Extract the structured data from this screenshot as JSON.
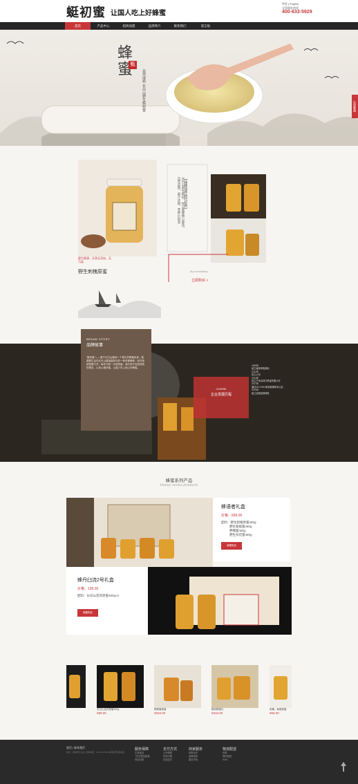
{
  "header": {
    "logo": "蜓初蜜",
    "slogan": "让国人吃上好蜂蜜",
    "lang": "中文 | English",
    "service": "全国服务热线",
    "phone": "400-633-5929"
  },
  "nav": {
    "items": [
      "首页",
      "产品中心",
      "招商加盟",
      "品牌简介",
      "联系我们",
      "留言板"
    ]
  },
  "banner": {
    "title": "蜂蜜",
    "seal": "甄",
    "subtitle": "自然成熟 长白山野生椴树蜜"
  },
  "side_tab": "在线客服",
  "featured": {
    "name": "野生刺槐原蜜",
    "subtitle": "野生蜜源，天然无添加，无污染",
    "vertical_text": "长白山野生椴树，经过蜜蜂精心酿造，自然成熟，蜜汁浓稠，营养价值高",
    "banner_text": "【 臻臻诚酿   韩世好蜜 】",
    "caption": "Buy immediately",
    "buy": "立即购买 >"
  },
  "story": {
    "en": "BRAND STORY",
    "zh": "品牌故事",
    "body": "“蜓初蜜”——源于长白山腹地一个神久的蜂蜜传承。蜜源是生活在长白山原始森林中的一种珍稀蜂种，回归传统割蜜方式，每年只取一次成熟蜜。我们坚守自然成熟的理念，以良心做好蜜，让国人吃上放心好蜂蜜。",
    "course_en": "COURSE",
    "course_zh": "企业发展历程",
    "timeline": [
      "1999年",
      "建立蜜蜂养殖基地",
      "2012年",
      "成立公司",
      "2014年",
      "成立千禾吉林打蜂蜜有限公司",
      "2017年",
      "通过ISO-9001质量管理体系认证",
      "2019年",
      "建立全国经销网络"
    ]
  },
  "products": {
    "title": "蜂蜜系列产品",
    "en": "Honey series products",
    "p1": {
      "name": "蜂语者礼盒",
      "price": "价格：699.00",
      "desc": [
        "配料：野生刺槐原蜜480g",
        "野生紫椴蜜480g",
        "野槐蜜480g",
        "野生杂花蜜480g"
      ],
      "btn": "我要购买"
    },
    "p2": {
      "name": "蜂丹臼流2号礼盒",
      "price": "价格：199.00",
      "desc": [
        "配料：长白山百花原蜜480g×2"
      ],
      "btn": "我要购买"
    },
    "thumbs": [
      {
        "label": "长白山百花原蜜480g",
        "price": "¥99.00"
      },
      {
        "label": "野蜂巢原蜜",
        "price": "¥203.00"
      },
      {
        "label": "椴树蜂蜜礼",
        "price": "¥310.00"
      },
      {
        "label": "刺槐、紫椴原蜜",
        "price": "¥69.00"
      }
    ]
  },
  "footer": {
    "links": [
      "首页",
      "联系我们"
    ],
    "small": "地址：吉林省长白山 咨询电话：400-633-5929 版权所有 蜓初蜜",
    "cols": [
      {
        "title": "服务保障",
        "items": [
          "正品保证",
          "7天无理由退换",
          "货到付款"
        ]
      },
      {
        "title": "支付方式",
        "items": [
          "公司转账",
          "货到付款",
          "在线支付"
        ]
      },
      {
        "title": "商家服务",
        "items": [
          "商家合作",
          "品牌招商",
          "服务市场"
        ]
      },
      {
        "title": "物流配送",
        "items": [
          "包邮",
          "海外配送",
          "EMS"
        ]
      }
    ]
  },
  "colors": {
    "accent": "#c8363a",
    "nav_bg": "#262626",
    "footer_bg": "#2a2a2a",
    "story_card": "#6e5a4a"
  }
}
